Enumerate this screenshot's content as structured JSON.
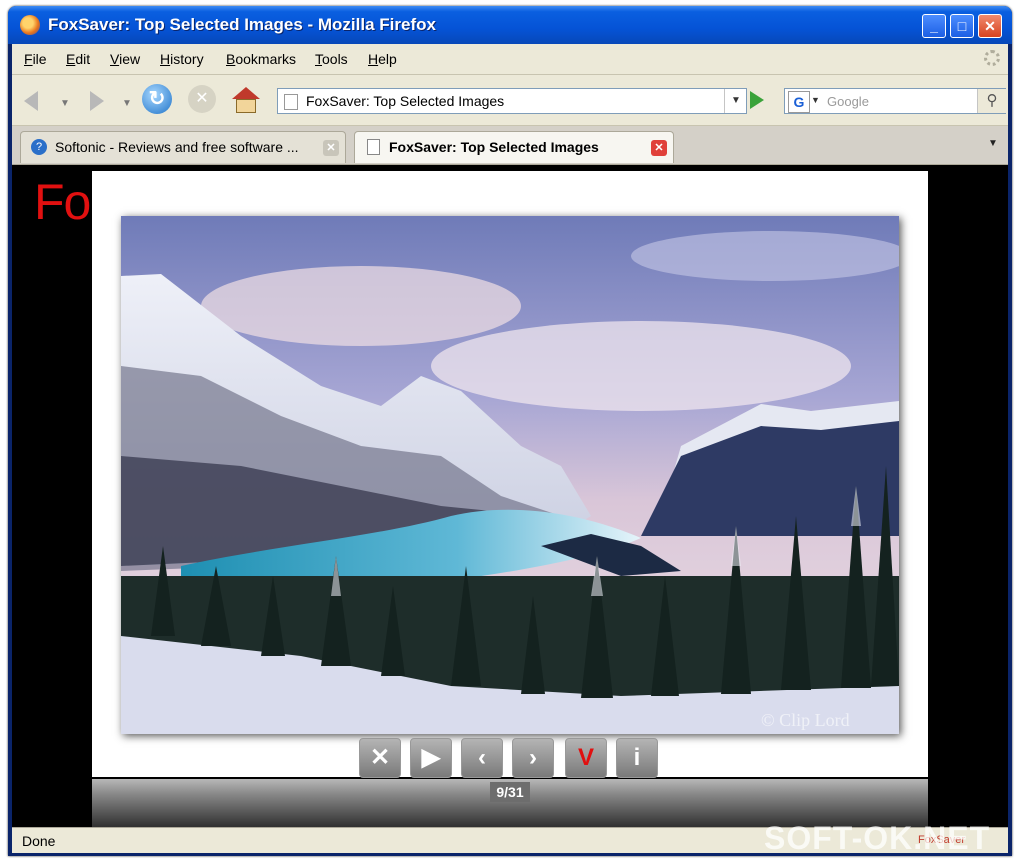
{
  "window": {
    "title": "FoxSaver: Top Selected Images - Mozilla Firefox"
  },
  "menu": {
    "items": [
      "File",
      "Edit",
      "View",
      "History",
      "Bookmarks",
      "Tools",
      "Help"
    ]
  },
  "navigation": {
    "url": "FoxSaver: Top Selected Images",
    "search_placeholder": "Google",
    "search_engine_letter": "G"
  },
  "tabs": [
    {
      "label": "Softonic - Reviews and free software ...",
      "active": false
    },
    {
      "label": "FoxSaver: Top Selected Images",
      "active": true
    }
  ],
  "page": {
    "brand_text": "Fo",
    "photo_credit": "© Clip Lord",
    "controls": {
      "close": "✕",
      "play": "▶",
      "prev": "‹",
      "next": "›",
      "select": "V",
      "info": "i"
    },
    "counter": "9/31"
  },
  "status": {
    "text": "Done",
    "addon_label": "FoxSaver"
  },
  "watermark": "SOFT-OK.NET",
  "colors": {
    "brand_red": "#e11010",
    "titlebar_blue": "#0553d6",
    "tab_close_red": "#e0403a"
  }
}
